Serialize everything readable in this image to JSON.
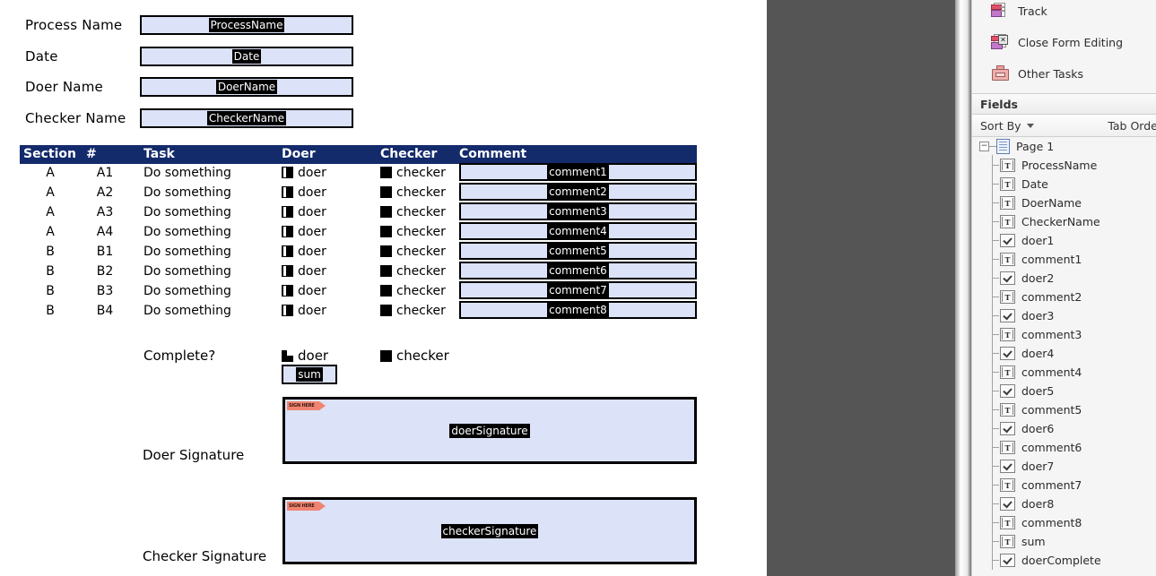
{
  "document": {
    "header_fields": [
      {
        "label": "Process Name",
        "field_name": "ProcessName"
      },
      {
        "label": "Date",
        "field_name": "Date"
      },
      {
        "label": "Doer Name",
        "field_name": "DoerName"
      },
      {
        "label": "Checker Name",
        "field_name": "CheckerName"
      }
    ],
    "table": {
      "columns": [
        "Section",
        "#",
        "Task",
        "Doer",
        "Checker",
        "Comment"
      ],
      "header_bg": "#132a6b",
      "header_fg": "#ffffff",
      "rows": [
        {
          "section": "A",
          "num": "A1",
          "task": "Do something",
          "doer": "doer",
          "checker": "checker",
          "comment_field": "comment1"
        },
        {
          "section": "A",
          "num": "A2",
          "task": "Do something",
          "doer": "doer",
          "checker": "checker",
          "comment_field": "comment2"
        },
        {
          "section": "A",
          "num": "A3",
          "task": "Do something",
          "doer": "doer",
          "checker": "checker",
          "comment_field": "comment3"
        },
        {
          "section": "A",
          "num": "A4",
          "task": "Do something",
          "doer": "doer",
          "checker": "checker",
          "comment_field": "comment4"
        },
        {
          "section": "B",
          "num": "B1",
          "task": "Do something",
          "doer": "doer",
          "checker": "checker",
          "comment_field": "comment5"
        },
        {
          "section": "B",
          "num": "B2",
          "task": "Do something",
          "doer": "doer",
          "checker": "checker",
          "comment_field": "comment6"
        },
        {
          "section": "B",
          "num": "B3",
          "task": "Do something",
          "doer": "doer",
          "checker": "checker",
          "comment_field": "comment7"
        },
        {
          "section": "B",
          "num": "B4",
          "task": "Do something",
          "doer": "doer",
          "checker": "checker",
          "comment_field": "comment8"
        }
      ]
    },
    "complete_row": {
      "label": "Complete?",
      "doer": "doer",
      "checker": "checker",
      "sum_field": "sum"
    },
    "signatures": [
      {
        "label": "Doer Signature",
        "field_name": "doerSignature",
        "tag_text": "SIGN HERE",
        "tag_color": "#f08470"
      },
      {
        "label": "Checker Signature",
        "field_name": "checkerSignature",
        "tag_text": "SIGN HERE",
        "tag_color": "#f08470"
      }
    ],
    "field_fill_color": "#dce2f8",
    "field_border_color": "#000000"
  },
  "right_panel": {
    "tasks": [
      {
        "label": "Track",
        "icon": "track-icon"
      },
      {
        "label": "Close Form Editing",
        "icon": "close-form-editing-icon"
      },
      {
        "label": "Other Tasks",
        "icon": "other-tasks-icon"
      }
    ],
    "fields_header": "Fields",
    "sort_by": "Sort By",
    "tab_order": "Tab Order",
    "tree": {
      "root": "Page 1",
      "expander": "−",
      "items": [
        {
          "name": "ProcessName",
          "type": "text"
        },
        {
          "name": "Date",
          "type": "text"
        },
        {
          "name": "DoerName",
          "type": "text"
        },
        {
          "name": "CheckerName",
          "type": "text"
        },
        {
          "name": "doer1",
          "type": "check"
        },
        {
          "name": "comment1",
          "type": "text"
        },
        {
          "name": "doer2",
          "type": "check"
        },
        {
          "name": "comment2",
          "type": "text"
        },
        {
          "name": "doer3",
          "type": "check"
        },
        {
          "name": "comment3",
          "type": "text"
        },
        {
          "name": "doer4",
          "type": "check"
        },
        {
          "name": "comment4",
          "type": "text"
        },
        {
          "name": "doer5",
          "type": "check"
        },
        {
          "name": "comment5",
          "type": "text"
        },
        {
          "name": "doer6",
          "type": "check"
        },
        {
          "name": "comment6",
          "type": "text"
        },
        {
          "name": "doer7",
          "type": "check"
        },
        {
          "name": "comment7",
          "type": "text"
        },
        {
          "name": "doer8",
          "type": "check"
        },
        {
          "name": "comment8",
          "type": "text"
        },
        {
          "name": "sum",
          "type": "text"
        },
        {
          "name": "doerComplete",
          "type": "check"
        }
      ]
    },
    "text_field_icon_glyph": "T"
  }
}
